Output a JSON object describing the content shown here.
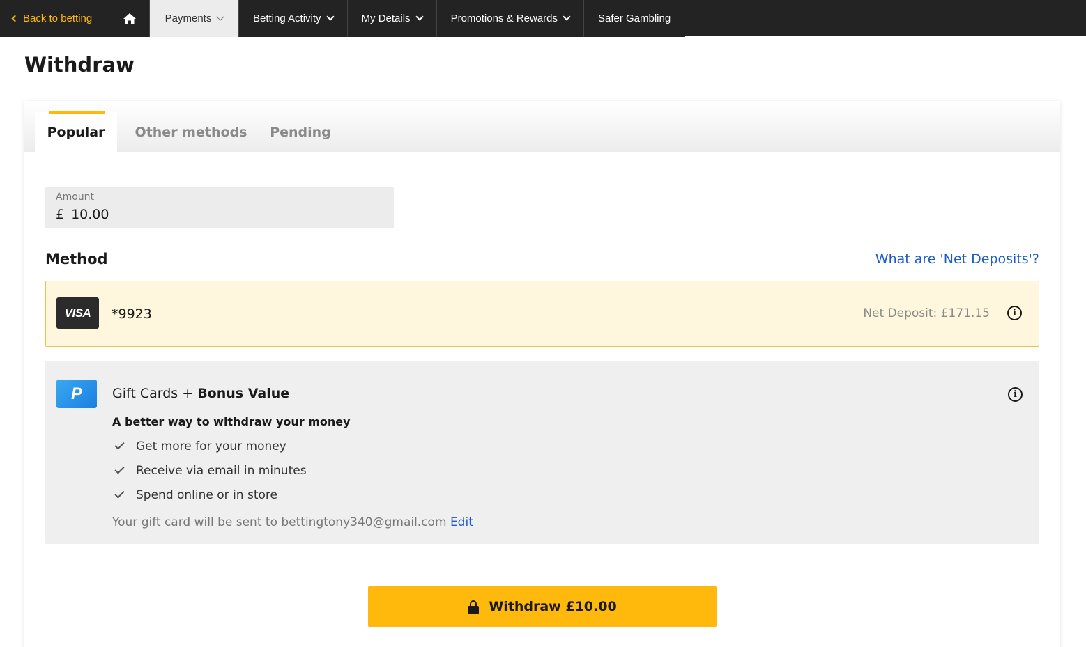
{
  "nav": {
    "back_label": "Back to betting",
    "items": [
      {
        "label": "Payments",
        "icon": "chevron-down-icon"
      },
      {
        "label": "Betting Activity",
        "icon": "chevron-down-icon"
      },
      {
        "label": "My Details",
        "icon": "chevron-down-icon"
      },
      {
        "label": "Promotions & Rewards",
        "icon": "chevron-down-icon"
      },
      {
        "label": "Safer Gambling"
      }
    ],
    "home_icon": "home-icon"
  },
  "page": {
    "title": "Withdraw"
  },
  "tabs": [
    {
      "label": "Popular",
      "active": true
    },
    {
      "label": "Other methods",
      "active": false
    },
    {
      "label": "Pending",
      "active": false
    }
  ],
  "amount": {
    "label": "Amount",
    "currency": "£",
    "value": "10.00"
  },
  "method": {
    "title": "Method",
    "net_deposits_link": "What are 'Net Deposits'?",
    "card": {
      "brand": "VISA",
      "number": "*9923",
      "net_deposit": "Net Deposit: £171.15",
      "info_icon": "info-icon"
    },
    "gift": {
      "title_prefix": "Gift Cards + ",
      "title_bold": "Bonus Value",
      "subtitle": "A better way to withdraw your money",
      "benefits": [
        "Get more for your money",
        "Receive via email in minutes",
        "Spend online or in store"
      ],
      "note": "Your gift card will be sent to bettingtony340@gmail.com",
      "edit_label": "Edit",
      "logo_letter": "P"
    }
  },
  "withdraw_button": {
    "label": "Withdraw £10.00",
    "icon": "lock-icon"
  },
  "colors": {
    "accent": "#ffb80c",
    "nav_bg": "#232323",
    "link": "#1a5cc8",
    "selected_bg": "#fff7dd"
  }
}
